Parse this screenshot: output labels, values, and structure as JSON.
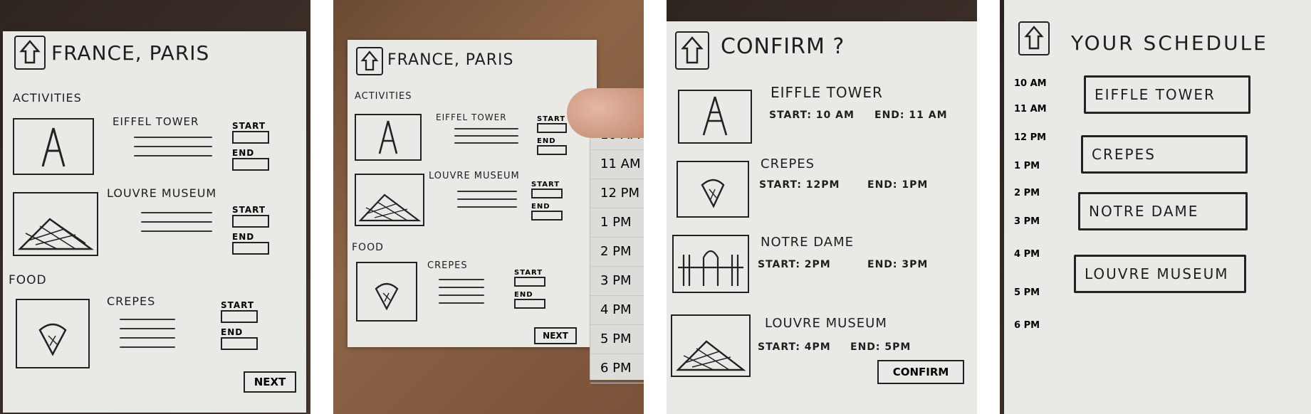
{
  "panels": [
    {
      "title": "FRANCE, PARIS",
      "sections": {
        "activities": "ACTIVITIES",
        "food": "FOOD"
      },
      "items": [
        {
          "name": "EIFFEL TOWER",
          "start": "START",
          "end": "END"
        },
        {
          "name": "LOUVRE MUSEUM",
          "start": "START",
          "end": "END"
        },
        {
          "name": "CREPES",
          "start": "START",
          "end": "END"
        }
      ],
      "next": "NEXT"
    },
    {
      "title": "FRANCE, PARIS",
      "sections": {
        "activities": "ACTIVITIES",
        "food": "FOOD"
      },
      "items": [
        {
          "name": "EIFFEL TOWER",
          "start": "START",
          "end": "END"
        },
        {
          "name": "LOUVRE MUSEUM",
          "start": "START",
          "end": "END"
        },
        {
          "name": "CREPES",
          "start": "START",
          "end": "END"
        }
      ],
      "next": "NEXT",
      "dropdown_times": [
        "10 AM",
        "11 AM",
        "12 PM",
        "1 PM",
        "2 PM",
        "3 PM",
        "4 PM",
        "5 PM",
        "6 PM"
      ]
    },
    {
      "title": "CONFIRM ?",
      "items": [
        {
          "name": "EIFFLE TOWER",
          "start": "START: 10 AM",
          "end": "END: 11 AM"
        },
        {
          "name": "CREPES",
          "start": "START: 12PM",
          "end": "END: 1PM"
        },
        {
          "name": "NOTRE DAME",
          "start": "START: 2PM",
          "end": "END: 3PM"
        },
        {
          "name": "LOUVRE MUSEUM",
          "start": "START: 4pm",
          "end": "END: 5PM"
        }
      ],
      "confirm": "CONFIRM"
    },
    {
      "title": "YOUR SCHEDULE",
      "times": [
        "10 AM",
        "11 AM",
        "12 PM",
        "1 PM",
        "2 PM",
        "3 PM",
        "4 PM",
        "5 PM",
        "6 PM"
      ],
      "slots": [
        "EIFFLE TOWER",
        "CREPES",
        "NOTRE DAME",
        "LOUVRE MUSEUM"
      ]
    }
  ]
}
